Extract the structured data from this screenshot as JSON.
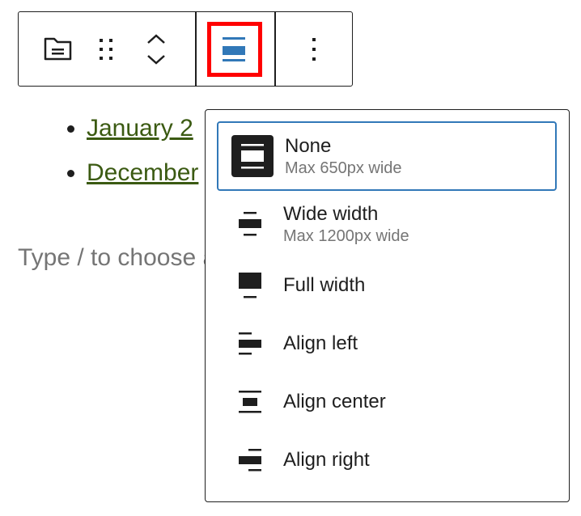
{
  "toolbar": {
    "buttons": [
      "block-type",
      "drag-handle",
      "move-up-down",
      "align",
      "options"
    ]
  },
  "content": {
    "list": [
      "January 2",
      "December"
    ],
    "placeholder": "Type / to choose a block"
  },
  "menu": {
    "items": [
      {
        "label": "None",
        "sub": "Max 650px wide",
        "icon": "align-none-icon",
        "selected": true
      },
      {
        "label": "Wide width",
        "sub": "Max 1200px wide",
        "icon": "align-wide-icon"
      },
      {
        "label": "Full width",
        "icon": "align-full-icon"
      },
      {
        "label": "Align left",
        "icon": "align-left-icon"
      },
      {
        "label": "Align center",
        "icon": "align-center-icon"
      },
      {
        "label": "Align right",
        "icon": "align-right-icon"
      }
    ]
  },
  "colors": {
    "accent": "#3178b8",
    "highlight": "#ff0000",
    "link": "#3b5a12"
  }
}
